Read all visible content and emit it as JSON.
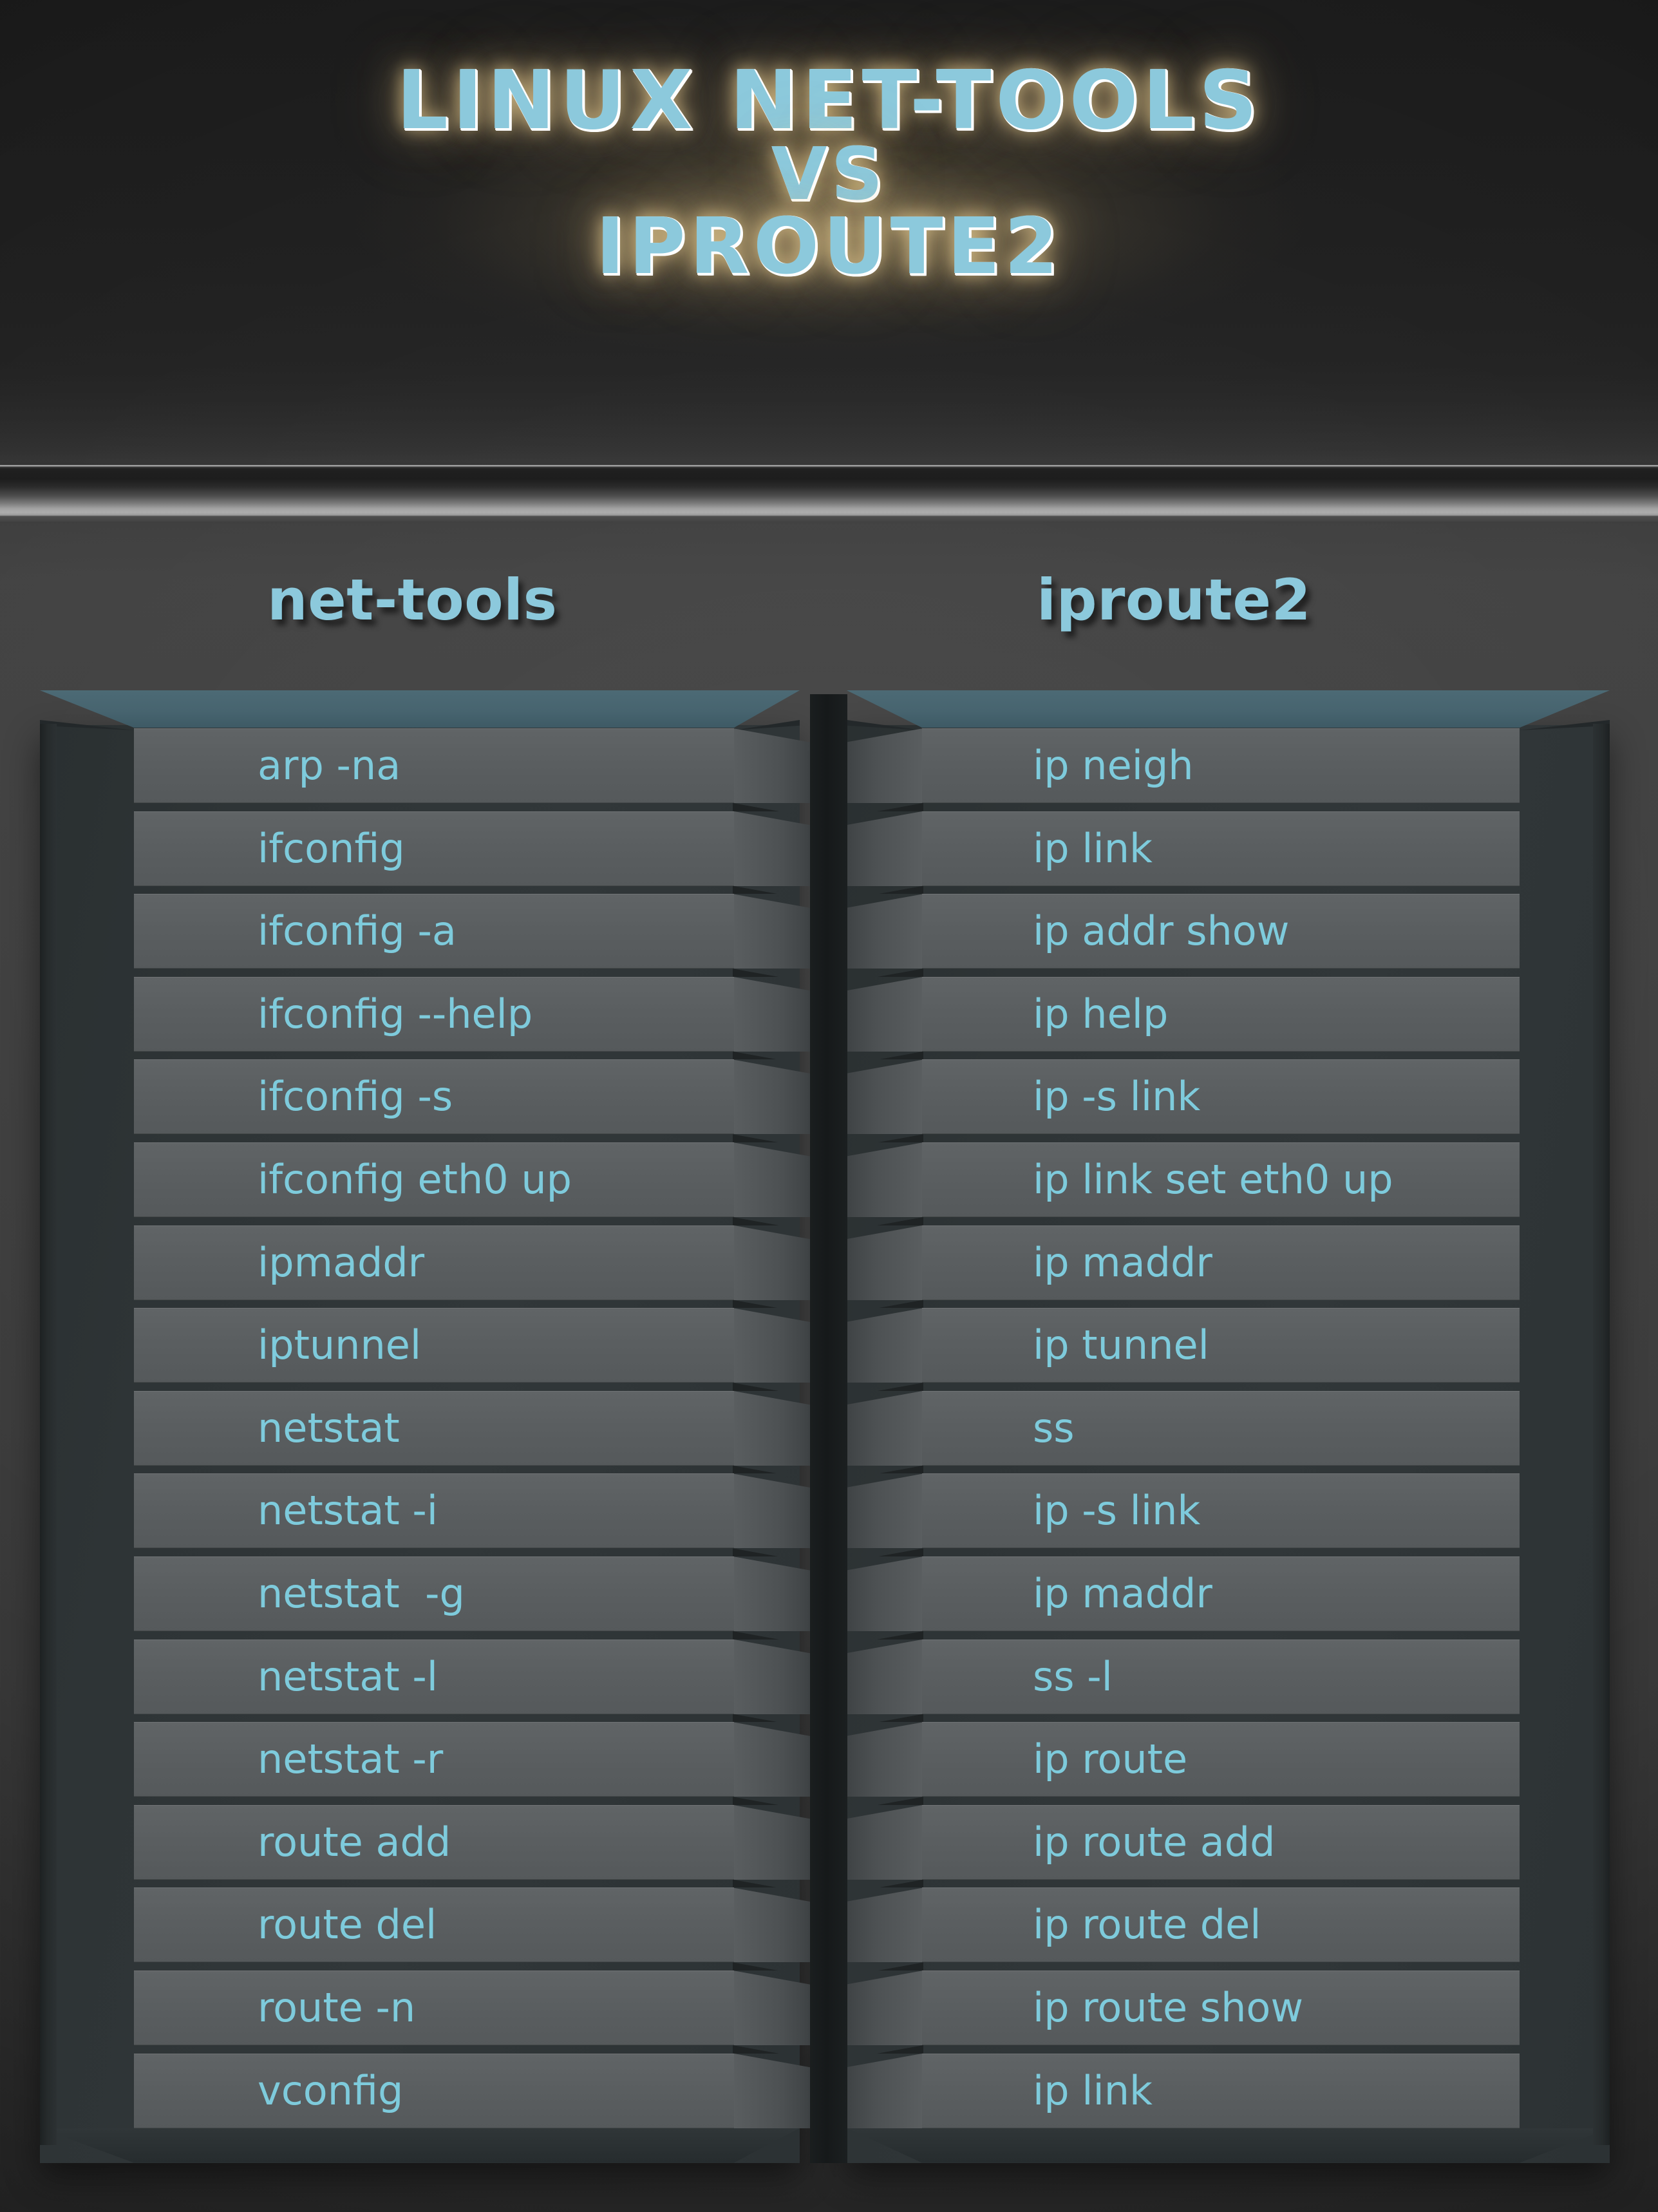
{
  "title": {
    "line1": "LINUX NET-TOOLS",
    "line2": "VS",
    "line3": "IPROUTE2"
  },
  "headers": {
    "left": "net-tools",
    "right": "iproute2"
  },
  "colors": {
    "accent_blue": "#8cc9dc",
    "row_text": "#7ecbdc",
    "row_fill": "#5a5e60",
    "frame": "#2e3436",
    "bevel_teal": "#47646f",
    "background": "#3b3b3b",
    "title_glow": "#ffe2a0"
  },
  "table": {
    "columns": [
      "net-tools",
      "iproute2"
    ],
    "rows": [
      {
        "net_tools": "arp -na",
        "iproute2": "ip neigh"
      },
      {
        "net_tools": "ifconfig",
        "iproute2": "ip link"
      },
      {
        "net_tools": "ifconfig -a",
        "iproute2": "ip addr show"
      },
      {
        "net_tools": "ifconfig --help",
        "iproute2": "ip help"
      },
      {
        "net_tools": "ifconfig -s",
        "iproute2": "ip -s link"
      },
      {
        "net_tools": "ifconfig eth0 up",
        "iproute2": "ip link set eth0 up"
      },
      {
        "net_tools": "ipmaddr",
        "iproute2": "ip maddr"
      },
      {
        "net_tools": "iptunnel",
        "iproute2": "ip tunnel"
      },
      {
        "net_tools": "netstat",
        "iproute2": "ss"
      },
      {
        "net_tools": "netstat -i",
        "iproute2": "ip -s link"
      },
      {
        "net_tools": "netstat  -g",
        "iproute2": "ip maddr"
      },
      {
        "net_tools": "netstat -l",
        "iproute2": "ss -l"
      },
      {
        "net_tools": "netstat -r",
        "iproute2": "ip route"
      },
      {
        "net_tools": "route add",
        "iproute2": "ip route add"
      },
      {
        "net_tools": "route del",
        "iproute2": "ip route del"
      },
      {
        "net_tools": "route -n",
        "iproute2": "ip route show"
      },
      {
        "net_tools": "vconfig",
        "iproute2": "ip link"
      }
    ]
  }
}
